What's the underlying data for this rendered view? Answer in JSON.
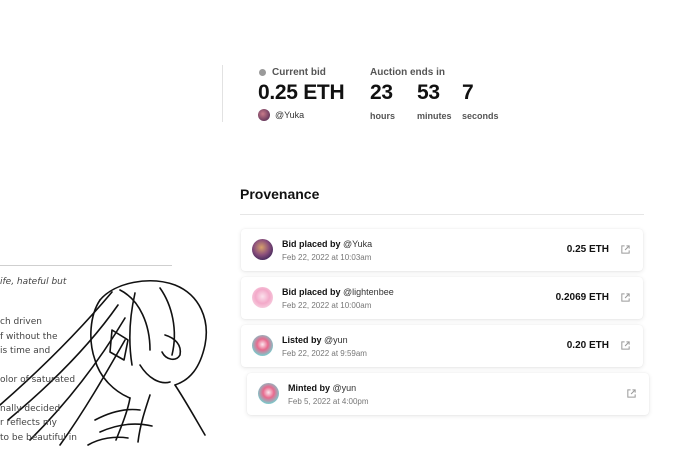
{
  "artwork": {
    "lines": [
      {
        "text": "ife, hateful but",
        "italic": true
      },
      {
        "text": "ch driven",
        "italic": false
      },
      {
        "text": "f without the",
        "italic": false
      },
      {
        "text": "is time and",
        "italic": false
      },
      {
        "text": "olor of saturated",
        "italic": false
      },
      {
        "text": "nally decided",
        "italic": false
      },
      {
        "text": "r reflects my",
        "italic": false
      },
      {
        "text": "to be beautiful in",
        "italic": false
      }
    ]
  },
  "current_bid": {
    "label": "Current bid",
    "amount": "0.25 ETH",
    "bidder": "@Yuka"
  },
  "auction": {
    "label": "Auction ends in",
    "hours": "23",
    "hours_label": "hours",
    "minutes": "53",
    "minutes_label": "minutes",
    "seconds": "7",
    "seconds_label": "seconds"
  },
  "provenance": {
    "title": "Provenance",
    "events": [
      {
        "action": "Bid placed by",
        "user": "@Yuka",
        "date": "Feb 22, 2022 at 10:03am",
        "amount": "0.25 ETH",
        "avatar": "yuka"
      },
      {
        "action": "Bid placed by",
        "user": "@lightenbee",
        "date": "Feb 22, 2022 at 10:00am",
        "amount": "0.2069 ETH",
        "avatar": "light"
      },
      {
        "action": "Listed by",
        "user": "@yun",
        "date": "Feb 22, 2022 at 9:59am",
        "amount": "0.20 ETH",
        "avatar": "yun"
      },
      {
        "action": "Minted by",
        "user": "@yun",
        "date": "Feb 5, 2022 at 4:00pm",
        "amount": "",
        "avatar": "yun"
      }
    ]
  },
  "icons": {
    "external_link": "external-link-icon"
  },
  "colors": {
    "text": "#111111",
    "muted": "#777777",
    "dot": "#9a9a9a"
  }
}
